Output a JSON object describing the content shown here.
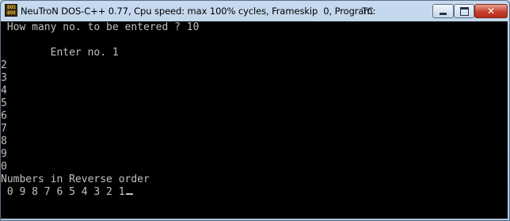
{
  "window": {
    "icon_line1": "DOS",
    "icon_line2": "BOX",
    "title": "NeuTroN DOS-C++ 0.77, Cpu speed: max 100% cycles, Frameskip  0, Program:",
    "program": "TC",
    "controls": {
      "minimize": "minimize",
      "maximize": "maximize",
      "close": "✕"
    }
  },
  "console": {
    "lines": [
      " How many no. to be entered ? 10",
      "",
      "        Enter no. 1",
      "2",
      "3",
      "4",
      "5",
      "6",
      "7",
      "8",
      "9",
      "0",
      "Numbers in Reverse order",
      " 0 9 8 7 6 5 4 3 2 1"
    ]
  }
}
